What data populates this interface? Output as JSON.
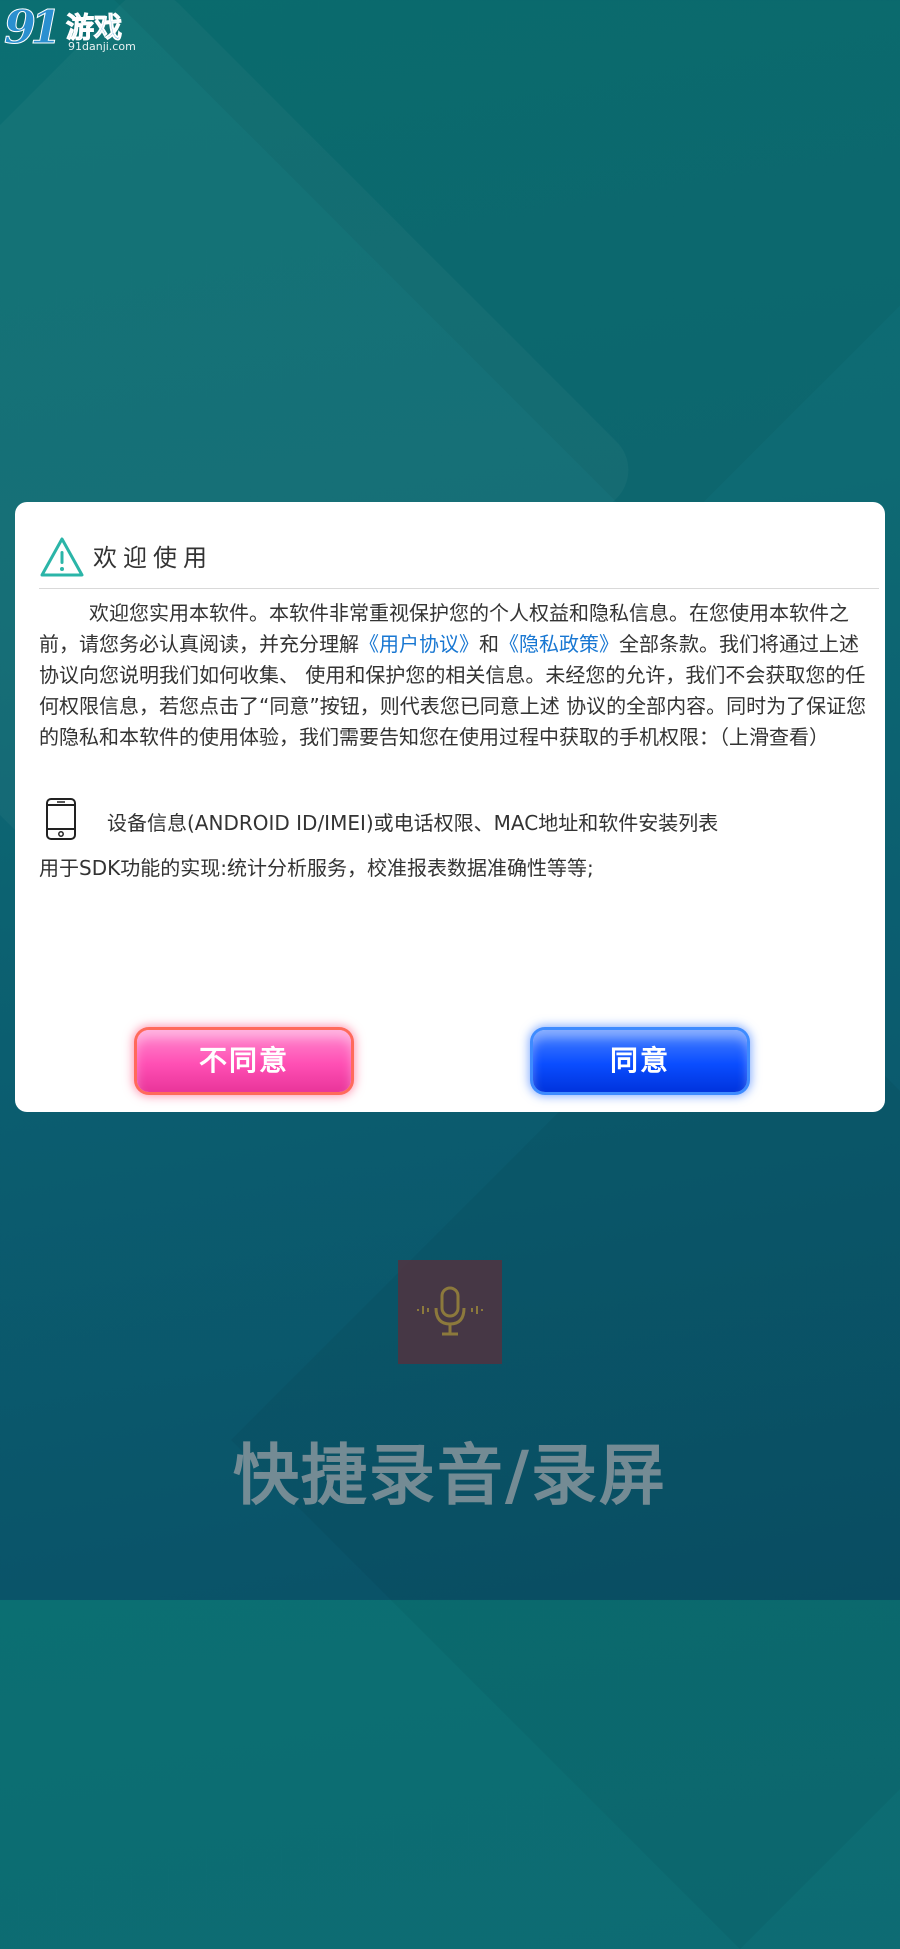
{
  "watermark": {
    "number": "91",
    "brand": "游戏",
    "url": "91danji.com"
  },
  "dialog": {
    "title": "欢迎使用",
    "body_part1": "欢迎您实用本软件。本软件非常重视保护您的个人权益和隐私信息。在您使用本软件之前，请您务必认真阅读，并充分理解",
    "user_agreement_link": "《用户协议》",
    "and_text": "和",
    "privacy_policy_link": "《隐私政策》",
    "body_part2": "全部条款。我们将通过上述协议向您说明我们如何收集、 使用和保护您的相关信息。未经您的允许，我们不会获取您的任何权限信息，若您点击了“同意”按钮，则代表您已同意上述 协议的全部内容。同时为了保证您的隐私和本软件的使用体验，我们需要告知您在使用过程中获取的手机权限：（上滑查看）",
    "permission": {
      "icon": "phone-icon",
      "label": "设备信息(ANDROID ID/IMEI)或电话权限、MAC地址和软件安装列表",
      "purpose": "用于SDK功能的实现:统计分析服务，校准报表数据准确性等等;"
    },
    "decline_label": "不同意",
    "agree_label": "同意"
  },
  "app": {
    "icon": "microphone-icon",
    "name": "快捷录音/录屏"
  },
  "colors": {
    "background": "#0b6a72",
    "link": "#1877d2",
    "decline_button": "#ff4fb4",
    "agree_button": "#0a4dff",
    "warning_icon": "#2bb5a8"
  }
}
